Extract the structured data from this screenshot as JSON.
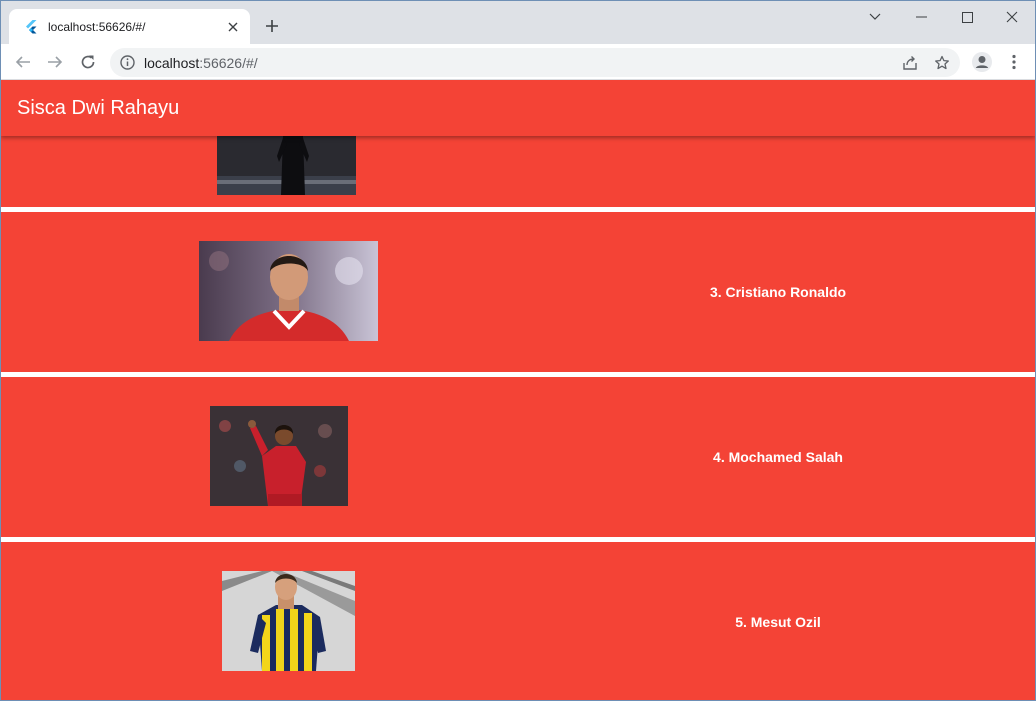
{
  "browser": {
    "tab_title": "localhost:56626/#/",
    "url_host": "localhost",
    "url_rest": ":56626/#/"
  },
  "app": {
    "title": "Sisca Dwi Rahayu",
    "players": [
      {
        "label": ""
      },
      {
        "label": "3. Cristiano Ronaldo"
      },
      {
        "label": "4. Mochamed Salah"
      },
      {
        "label": "5. Mesut Ozil"
      }
    ]
  },
  "colors": {
    "card_background": "#f44336",
    "appbar_background": "#f44336"
  },
  "icons": [
    "flutter-icon",
    "close-icon",
    "plus-icon",
    "chevron-down-icon",
    "minimize-icon",
    "maximize-icon",
    "back-icon",
    "forward-icon",
    "reload-icon",
    "info-icon",
    "share-icon",
    "star-icon",
    "profile-icon",
    "more-icon"
  ]
}
